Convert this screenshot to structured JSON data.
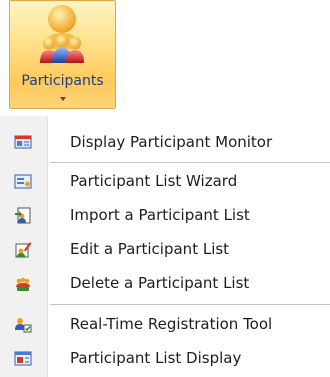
{
  "ribbon_button": {
    "label": "Participants",
    "icon": "people-group-icon"
  },
  "menu": {
    "items": [
      {
        "label": "Display Participant Monitor",
        "icon": "monitor-icon"
      },
      {
        "label": "Participant List Wizard",
        "icon": "list-wizard-icon"
      },
      {
        "label": "Import a Participant List",
        "icon": "import-list-icon"
      },
      {
        "label": "Edit a Participant List",
        "icon": "edit-list-icon"
      },
      {
        "label": "Delete a Participant List",
        "icon": "delete-list-icon"
      },
      {
        "label": "Real-Time Registration Tool",
        "icon": "registration-tool-icon"
      },
      {
        "label": "Participant List Display",
        "icon": "list-display-icon"
      }
    ]
  },
  "colors": {
    "ribbon_label": "#15428b",
    "ribbon_highlight": "#ffc95a",
    "menu_text": "#1e1e1e"
  }
}
